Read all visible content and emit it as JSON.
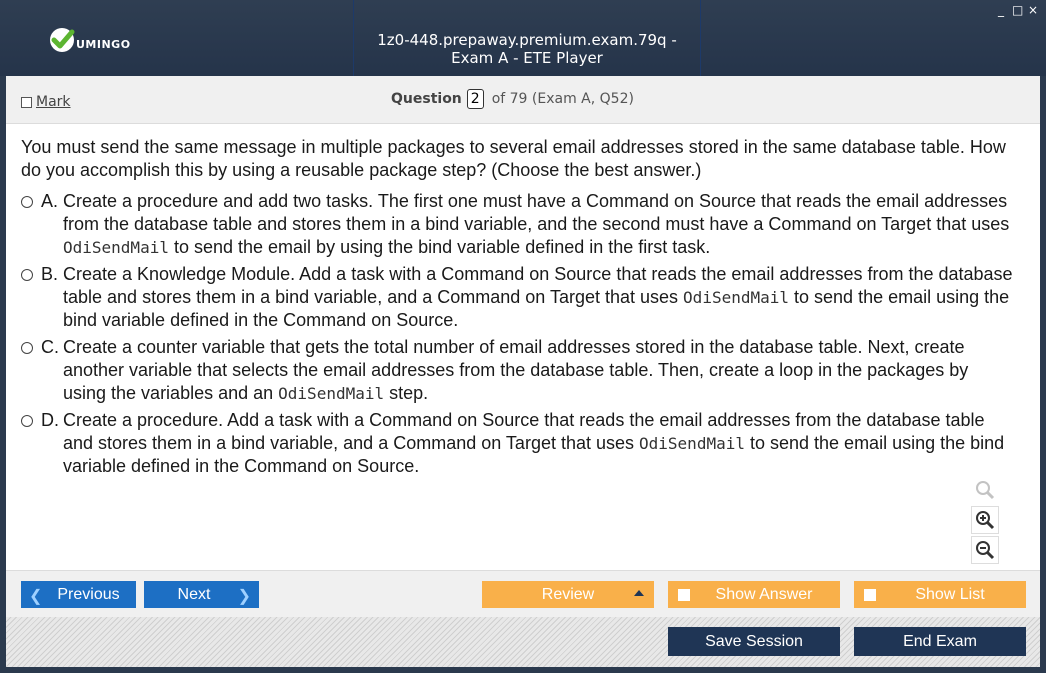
{
  "window": {
    "title": "1z0-448.prepaway.premium.exam.79q - Exam A - ETE Player",
    "logo_text": "UMINGO",
    "controls": [
      "_",
      "□",
      "×"
    ]
  },
  "header": {
    "mark_label": "Mark",
    "question_label": "Question",
    "question_number": "2",
    "question_of": "of 79 (Exam A, Q52)"
  },
  "question": {
    "text": "You must send the same message in multiple packages to several email addresses stored in the same database table. How do you accomplish this by using a reusable package step? (Choose the best answer.)",
    "options": [
      {
        "letter": "A.",
        "pre": "Create a procedure and add two tasks. The first one must have a Command on Source that reads the email addresses from the database table and stores them in a bind variable, and the second must have a Command on Target that uses ",
        "code": "OdiSendMail",
        "post": " to send the email by using the bind variable defined in the first task."
      },
      {
        "letter": "B.",
        "pre": "Create a Knowledge Module. Add a task with a Command on Source that reads the email addresses from the database table and stores them in a bind variable, and a Command on Target that uses ",
        "code": "OdiSendMail",
        "post": " to send the email using the bind variable defined in the Command on Source."
      },
      {
        "letter": "C.",
        "pre": "Create a counter variable that gets the total number of email addresses stored in the database table. Next, create another variable that selects the email addresses from the database table. Then, create a loop in the packages by using the variables and an ",
        "code": "OdiSendMail",
        "post": " step."
      },
      {
        "letter": "D.",
        "pre": "Create a procedure. Add a task with a Command on Source that reads the email addresses from the database table and stores them in a bind variable, and a Command on Target that uses ",
        "code": "OdiSendMail",
        "post": " to send the email using the bind variable defined in the Command on Source."
      }
    ]
  },
  "nav": {
    "previous": "Previous",
    "next": "Next",
    "review": "Review",
    "show_answer": "Show Answer",
    "show_list": "Show List"
  },
  "session": {
    "save": "Save Session",
    "end": "End Exam"
  },
  "colors": {
    "titlebar": "#2b3a4e",
    "blue_button": "#1d6fc4",
    "orange_button": "#f9b04a",
    "dark_button": "#1f3555",
    "logo_check": "#5cb531"
  },
  "icons": [
    "check-logo-icon",
    "search-icon",
    "zoom-in-icon",
    "zoom-out-icon",
    "chevron-left-icon",
    "chevron-right-icon",
    "caret-up-icon"
  ]
}
